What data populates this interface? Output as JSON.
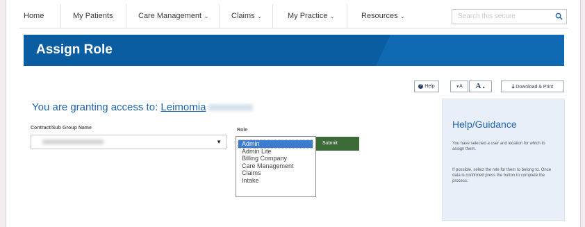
{
  "nav": {
    "items": [
      {
        "label": "Home",
        "chevron": false
      },
      {
        "label": "My Patients",
        "chevron": false
      },
      {
        "label": "Care Management",
        "chevron": true
      },
      {
        "label": "Claims",
        "chevron": true
      },
      {
        "label": "My Practice",
        "chevron": true
      },
      {
        "label": "Resources",
        "chevron": true
      }
    ],
    "search_placeholder": "Search this secure"
  },
  "banner": {
    "title": "Assign Role"
  },
  "tools": {
    "help": "Help",
    "text_small": "A",
    "text_large": "A",
    "download": "Download & Print"
  },
  "granting": {
    "prefix": "You are granting access to:",
    "name": "Leimomia"
  },
  "form": {
    "contract_label": "Contract/Sub Group Name",
    "role_label": "Role",
    "role_options": [
      "Admin",
      "Admin Lite",
      "Billing Company",
      "Care Management",
      "Claims",
      "Intake"
    ],
    "selected_role": "Admin",
    "submit_label": "Submit"
  },
  "help": {
    "title": "Help/Guidance",
    "para1": "You have selected a user and location for which to assign them.",
    "para2": "If possible, select the role for them to belong to. Once data is confirmed press the button to complete the process."
  }
}
